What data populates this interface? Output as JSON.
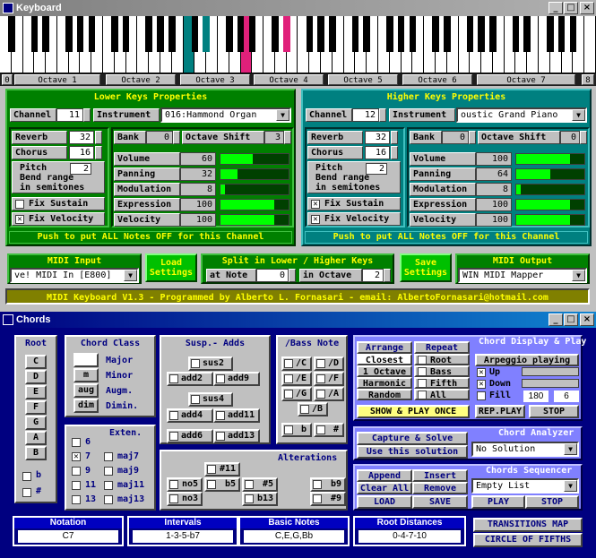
{
  "keyboard_window": {
    "title": "Keyboard",
    "minimize": "_",
    "maximize": "□",
    "close": "×"
  },
  "octaves": [
    "0",
    "Octave 1",
    "Octave 2",
    "Octave 3",
    "Octave 4",
    "Octave 5",
    "Octave 6",
    "Octave 7",
    "8"
  ],
  "lower": {
    "title": "Lower Keys Properties",
    "channel_label": "Channel",
    "channel": "11",
    "instrument_label": "Instrument",
    "instrument": "016:Hammond Organ",
    "reverb_label": "Reverb",
    "reverb": "32",
    "chorus_label": "Chorus",
    "chorus": "16",
    "pitch_label": "Pitch",
    "pitch": "2",
    "bend_text": "Bend range",
    "semis_text": "in semitones",
    "bank_label": "Bank",
    "bank": "0",
    "octshift_label": "Octave Shift",
    "octshift": "3",
    "volume_label": "Volume",
    "volume": "60",
    "panning_label": "Panning",
    "panning": "32",
    "modulation_label": "Modulation",
    "modulation": "8",
    "expression_label": "Expression",
    "expression": "100",
    "velocity_label": "Velocity",
    "velocity": "100",
    "fix_sustain": "Fix Sustain",
    "fix_velocity": "Fix Velocity",
    "alloff": "Push to put ALL Notes OFF for this Channel"
  },
  "higher": {
    "title": "Higher Keys Properties",
    "channel_label": "Channel",
    "channel": "12",
    "instrument_label": "Instrument",
    "instrument": "oustic Grand Piano",
    "reverb_label": "Reverb",
    "reverb": "32",
    "chorus_label": "Chorus",
    "chorus": "16",
    "pitch_label": "Pitch",
    "pitch": "2",
    "bend_text": "Bend range",
    "semis_text": "in semitones",
    "bank_label": "Bank",
    "bank": "0",
    "octshift_label": "Octave Shift",
    "octshift": "0",
    "volume_label": "Volume",
    "volume": "100",
    "panning_label": "Panning",
    "panning": "64",
    "modulation_label": "Modulation",
    "modulation": "8",
    "expression_label": "Expression",
    "expression": "100",
    "velocity_label": "Velocity",
    "velocity": "100",
    "fix_sustain": "Fix Sustain",
    "fix_velocity": "Fix Velocity",
    "alloff": "Push to put ALL Notes OFF for this Channel"
  },
  "levels": {
    "lower": {
      "volume": 0.47,
      "panning": 0.25,
      "modulation": 0.06,
      "expression": 0.79,
      "velocity": 0.79
    },
    "higher": {
      "volume": 0.79,
      "panning": 0.5,
      "modulation": 0.06,
      "expression": 0.79,
      "velocity": 0.79
    }
  },
  "midi_input": {
    "title": "MIDI Input",
    "value": "ve! MIDI In [E800]"
  },
  "load_settings": "Load Settings",
  "split": {
    "title": "Split in Lower / Higher Keys",
    "at_note": "at Note",
    "note": "0",
    "in_octave": "in Octave",
    "octave": "2"
  },
  "save_settings": "Save Settings",
  "midi_output": {
    "title": "MIDI Output",
    "value": "WIN MIDI Mapper"
  },
  "banner": "MIDI Keyboard V1.3 - Programmed by Alberto L. Fornasari - email: AlbertoFornasari@hotmail.com",
  "chords_window": {
    "title": "Chords",
    "minimize": "_",
    "maximize": "□",
    "close": "×"
  },
  "root": {
    "title": "Root",
    "notes": [
      "C",
      "D",
      "E",
      "F",
      "G",
      "A",
      "B"
    ],
    "flat": "b",
    "sharp": "#"
  },
  "chord_class": {
    "title": "Chord Class",
    "items": [
      {
        "btn": "",
        "label": "Major"
      },
      {
        "btn": "m",
        "label": "Minor"
      },
      {
        "btn": "aug",
        "label": "Augm."
      },
      {
        "btn": "dim",
        "label": "Dimin."
      }
    ]
  },
  "exten": {
    "title": "Exten.",
    "items": [
      "6",
      "7",
      "9",
      "11",
      "13"
    ],
    "maj": [
      "maj7",
      "maj9",
      "maj11",
      "maj13"
    ]
  },
  "susp": {
    "title": "Susp.- Adds",
    "sus2": "sus2",
    "add2": "add2",
    "add9": "add9",
    "sus4": "sus4",
    "add4": "add4",
    "add11": "add11",
    "add6": "add6",
    "add13": "add13"
  },
  "bass": {
    "title": "/Bass Note",
    "items": [
      "/C",
      "/D",
      "/E",
      "/F",
      "/G",
      "/A",
      "/B",
      "b",
      "#"
    ]
  },
  "alterations": {
    "title": "Alterations",
    "items": [
      "#11",
      "no5",
      "b5",
      "#5",
      "b9",
      "no3",
      "b13",
      "#9"
    ]
  },
  "arrange": {
    "title": "Arrange",
    "items": [
      "Closest",
      "1 Octave",
      "Harmonic",
      "Random"
    ]
  },
  "repeat": {
    "title": "Repeat",
    "items": [
      "Root",
      "Bass",
      "Fifth",
      "All"
    ]
  },
  "show_play": "SHOW & PLAY ONCE",
  "display": {
    "title": "Chord Display & Play",
    "arpeggio": "Arpeggio playing",
    "up": "Up",
    "down": "Down",
    "fill": "Fill",
    "v1": "180",
    "v2": "6",
    "rep": "REP.PLAY",
    "stop": "STOP"
  },
  "capture": "Capture & Solve",
  "use_solution": "Use this solution",
  "analyzer": {
    "title": "Chord Analyzer",
    "value": "No Solution"
  },
  "seq_buttons": {
    "append": "Append",
    "insert": "Insert",
    "clear": "Clear All",
    "remove": "Remove",
    "load": "LOAD",
    "save": "SAVE"
  },
  "sequencer": {
    "title": "Chords Sequencer",
    "value": "Empty List",
    "play": "PLAY",
    "stop": "STOP"
  },
  "notation": {
    "title": "Notation",
    "value": "C7"
  },
  "intervals": {
    "title": "Intervals",
    "value": "1-3-5-b7"
  },
  "basic_notes": {
    "title": "Basic Notes",
    "value": "C,E,G,Bb"
  },
  "root_dist": {
    "title": "Root Distances",
    "value": "0-4-7-10"
  },
  "transitions": "TRANSITIONS MAP",
  "circle": "CIRCLE OF FIFTHS",
  "colors": {
    "pressed_key": "#e0207a",
    "highlight_key": "#008080"
  }
}
